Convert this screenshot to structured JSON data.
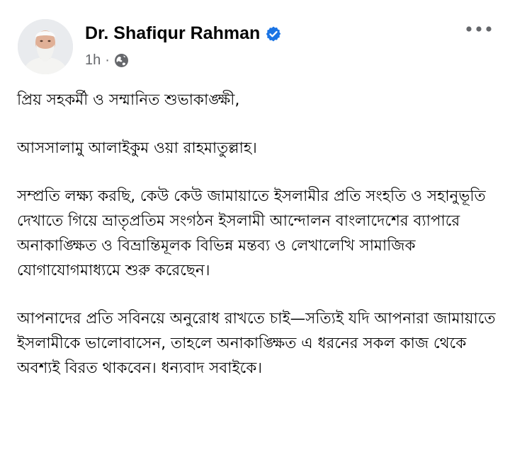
{
  "post": {
    "author_name": "Dr. Shafiqur Rahman",
    "time_ago": "1h",
    "separator": "·",
    "privacy_icon": "globe-icon",
    "verified_icon": "verified-badge-icon",
    "more_icon": "more-options-icon",
    "paragraphs": [
      "প্রিয় সহকর্মী ও সম্মানিত শুভাকাঙ্ক্ষী,",
      "আসসালামু আলাইকুম ওয়া রাহমাতুল্লাহ।",
      "সম্প্রতি লক্ষ্য করছি, কেউ কেউ জামায়াতে ইসলামীর প্রতি সংহতি ও সহানুভূতি দেখাতে গিয়ে ভ্রাতৃপ্রতিম সংগঠন ইসলামী আন্দোলন বাংলাদেশের ব্যাপারে অনাকাঙ্ক্ষিত ও বিভ্রান্তিমূলক বিভিন্ন মন্তব্য ও লেখালেখি সামাজিক যোগাযোগমাধ্যমে শুরু করেছেন।",
      "আপনাদের প্রতি সবিনয়ে অনুরোধ রাখতে চাই—সত্যিই যদি আপনারা জামায়াতে ইসলামীকে ভালোবাসেন, তাহলে অনাকাঙ্ক্ষিত এ ধরনের সকল কাজ থেকে অবশ্যই বিরত থাকবেন। ধন্যবাদ সবাইকে।"
    ]
  },
  "colors": {
    "verified": "#1b74e4",
    "secondary_text": "#65676b",
    "primary_text": "#050505"
  }
}
